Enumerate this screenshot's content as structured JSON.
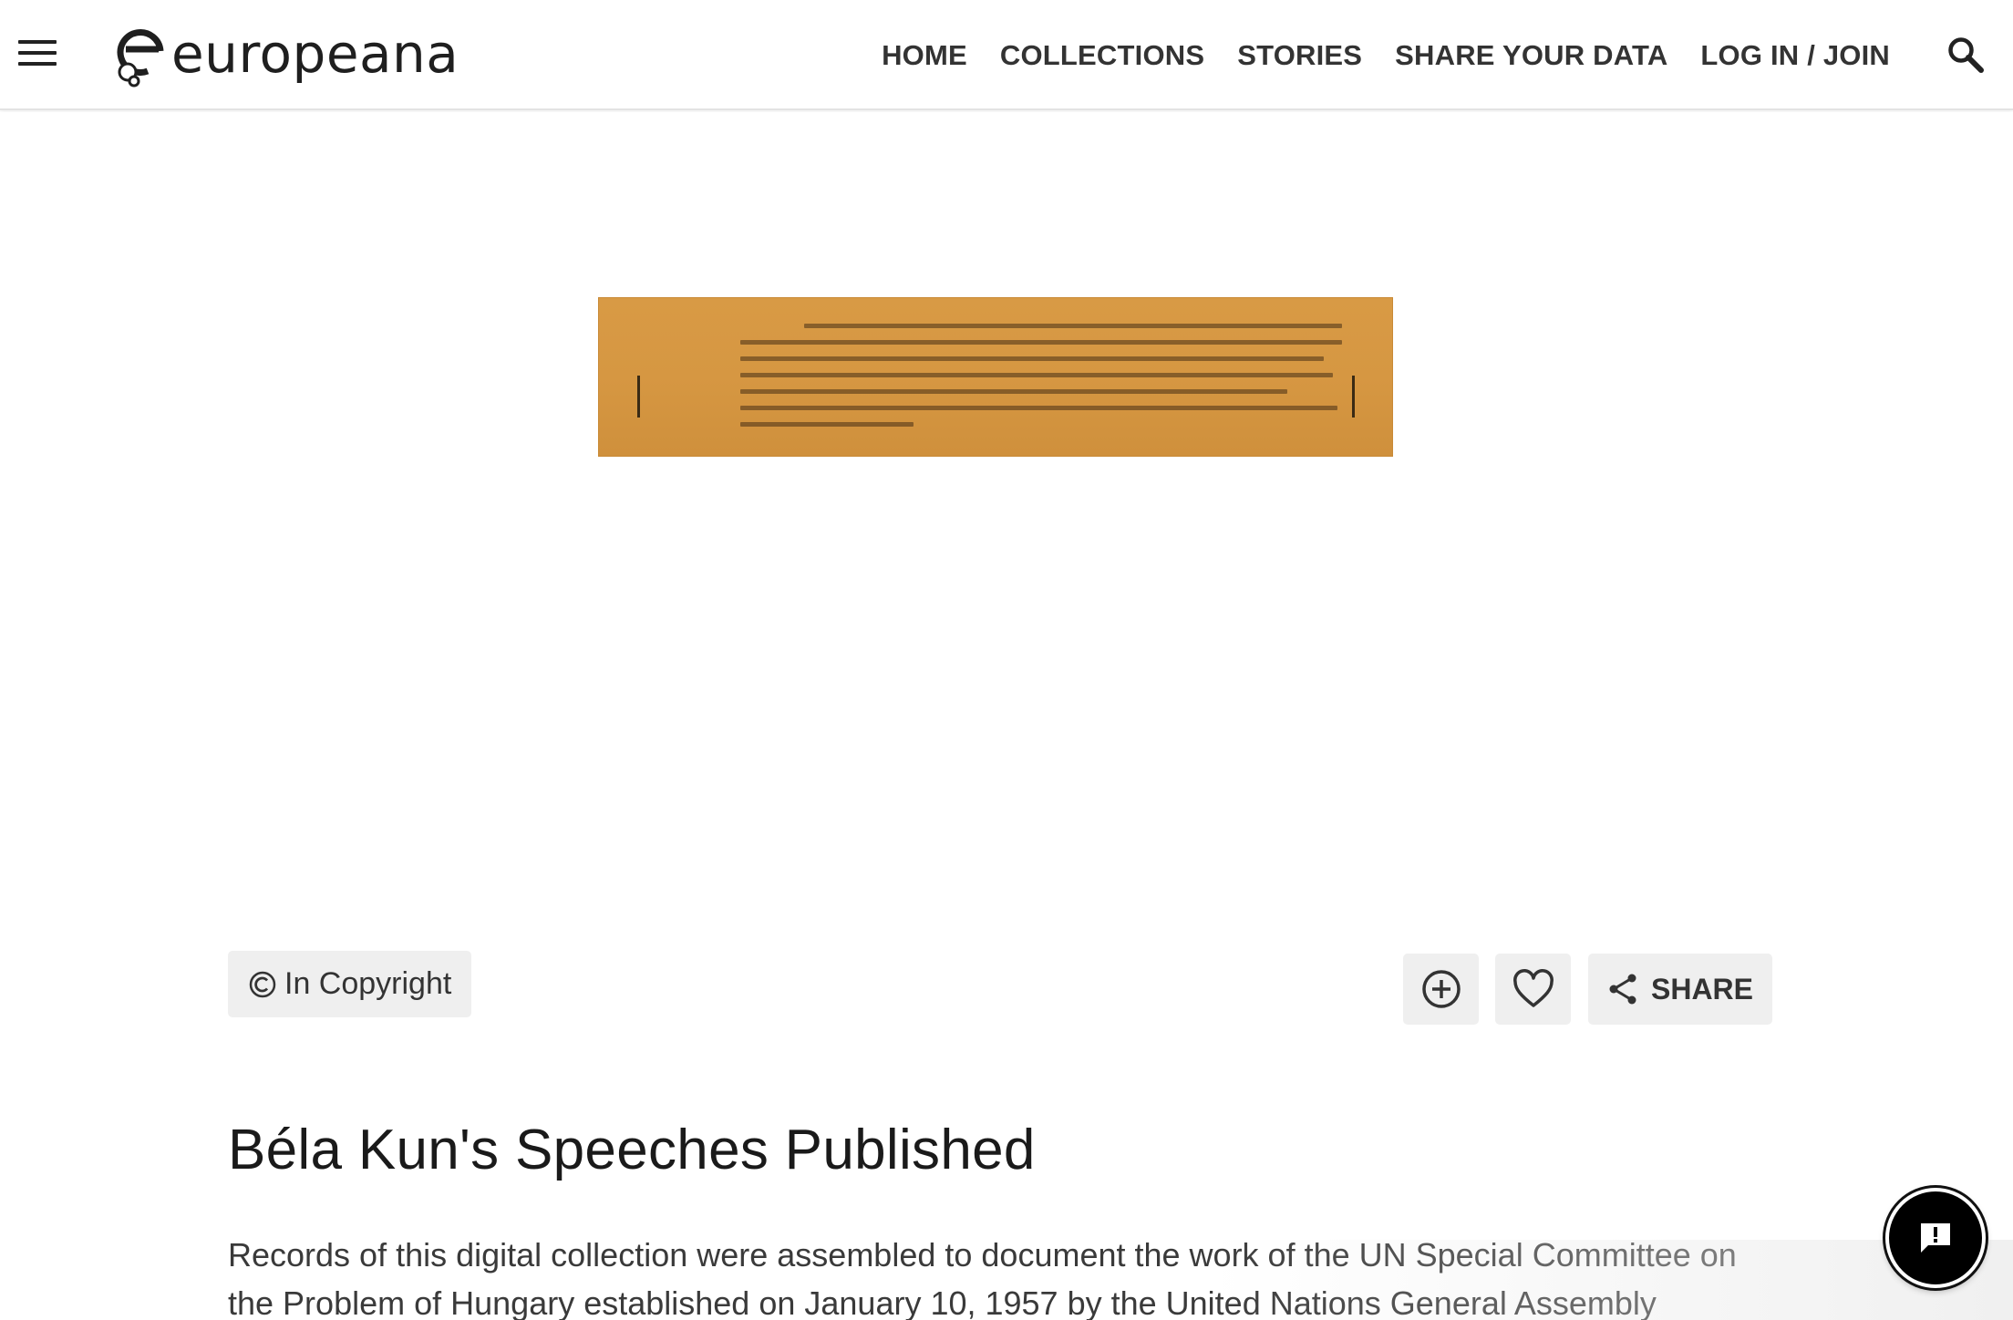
{
  "header": {
    "logo_text": "europeana",
    "nav": [
      "HOME",
      "COLLECTIONS",
      "STORIES",
      "SHARE YOUR DATA",
      "LOG IN / JOIN"
    ]
  },
  "rights": {
    "label": "In Copyright"
  },
  "actions": {
    "share_label": "SHARE"
  },
  "item": {
    "title": "Béla Kun's Speeches Published",
    "description": "Records of this digital collection were assembled to document the work of the UN Special Committee on the Problem of Hungary established on January 10, 1957 by the United Nations General Assembly"
  },
  "colors": {
    "accent": "#333333",
    "badge_bg": "#efefef",
    "document": "#d89a45"
  },
  "icons": [
    "menu-icon",
    "europeana-logo",
    "search-icon",
    "copyright-icon",
    "add-to-gallery-icon",
    "heart-icon",
    "share-icon",
    "feedback-icon"
  ]
}
